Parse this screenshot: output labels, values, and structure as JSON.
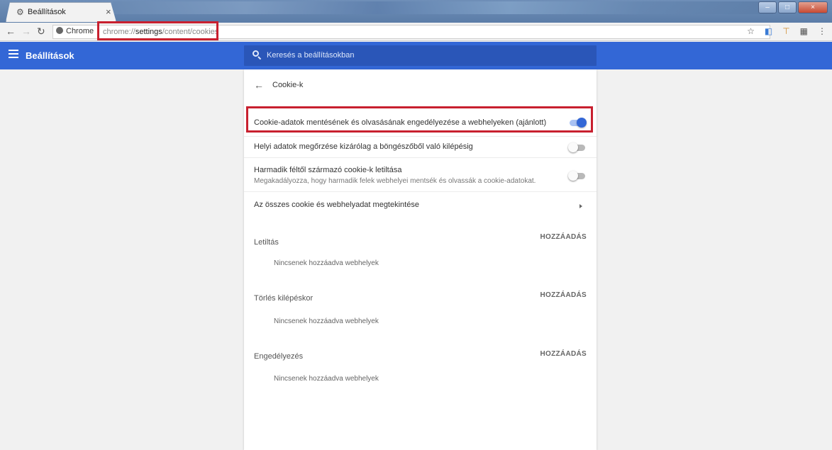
{
  "browser": {
    "tab_title": "Beállítások",
    "tab_close": "×",
    "omnibox_chip": "Chrome",
    "url_prefix": "chrome://",
    "url_bold": "settings",
    "url_suffix": "/content/cookies",
    "window_controls": [
      "–",
      "□",
      "×"
    ]
  },
  "header": {
    "title": "Beállítások",
    "search_placeholder": "Keresés a beállításokban"
  },
  "page": {
    "back_label": "←",
    "title": "Cookie-k"
  },
  "settings": {
    "allow_cookies": {
      "label": "Cookie-adatok mentésének és olvasásának engedélyezése a webhelyeken (ajánlott)",
      "enabled": true
    },
    "local_only": {
      "label": "Helyi adatok megőrzése kizárólag a böngészőből való kilépésig",
      "enabled": false
    },
    "block_third_party": {
      "label": "Harmadik féltől származó cookie-k letiltása",
      "sublabel": "Megakadályozza, hogy harmadik felek webhelyei mentsék és olvassák a cookie-adatokat.",
      "enabled": false
    },
    "all_cookies": {
      "label": "Az összes cookie és webhelyadat megtekintése"
    }
  },
  "sections": {
    "block": {
      "title": "Letiltás",
      "action": "HOZZÁADÁS",
      "empty": "Nincsenek hozzáadva webhelyek"
    },
    "clear_on_exit": {
      "title": "Törlés kilépéskor",
      "action": "HOZZÁADÁS",
      "empty": "Nincsenek hozzáadva webhelyek"
    },
    "allow": {
      "title": "Engedélyezés",
      "action": "HOZZÁADÁS",
      "empty": "Nincsenek hozzáadva webhelyek"
    }
  },
  "colors": {
    "header_blue": "#3367d6",
    "highlight_red": "#c8202f",
    "toggle_on": "#3367d6"
  }
}
